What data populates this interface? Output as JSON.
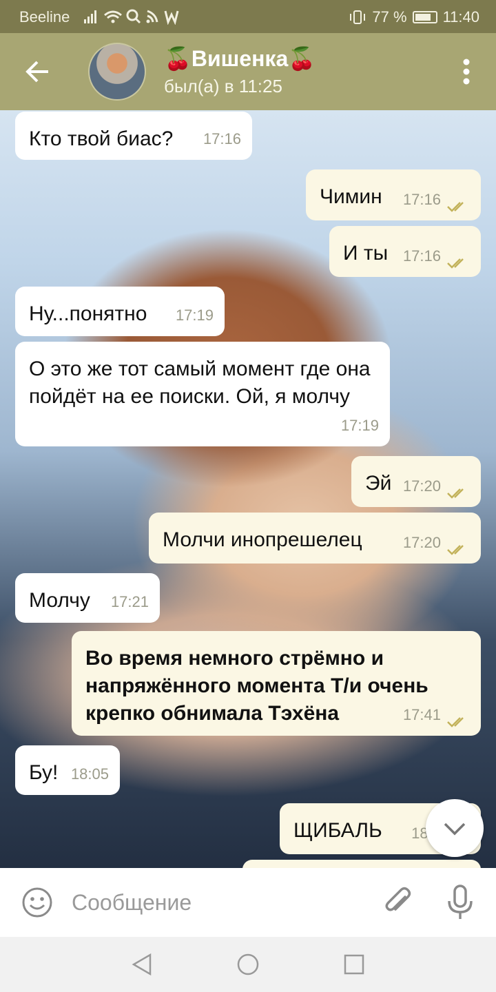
{
  "status_bar": {
    "carrier": "Beeline",
    "battery": "77 %",
    "battery_level": 0.77,
    "time": "11:40"
  },
  "header": {
    "contact_name": "🍒Вишенка🍒",
    "status": "был(а) в 11:25"
  },
  "messages": [
    {
      "dir": "in",
      "text": "Кто твой биас?",
      "time": "17:16"
    },
    {
      "dir": "out",
      "text": "Чимин",
      "time": "17:16",
      "read": true
    },
    {
      "dir": "out",
      "text": "И ты",
      "time": "17:16",
      "read": true
    },
    {
      "dir": "in",
      "text": "Ну...понятно",
      "time": "17:19"
    },
    {
      "dir": "in",
      "text": "О это же тот самый момент где она пойдёт на ее поиски. Ой, я молчу",
      "time": "17:19"
    },
    {
      "dir": "out",
      "text": "Эй",
      "time": "17:20",
      "read": true
    },
    {
      "dir": "out",
      "text": "Молчи инопрешелец",
      "time": "17:20",
      "read": true
    },
    {
      "dir": "in",
      "text": "Молчу",
      "time": "17:21"
    },
    {
      "dir": "out",
      "text": "Во время немного стрёмно и напряжённого момента Т/и очень крепко обнимала Тэхёна",
      "time": "17:41",
      "read": true,
      "bold": true
    },
    {
      "dir": "in",
      "text": "Бу!",
      "time": "18:05"
    },
    {
      "dir": "out",
      "text": "ЩИБАЛЬ",
      "time": "18:0",
      "read": true
    }
  ],
  "input": {
    "placeholder": "Сообщение"
  },
  "colors": {
    "header": "#a8a673",
    "status_bar": "#7d7a4e",
    "incoming_bubble": "#ffffff",
    "outgoing_bubble": "#fbf7e4",
    "read_check": "#c2b25a"
  },
  "icons": [
    "back-arrow-icon",
    "more-vert-icon",
    "emoji-icon",
    "paperclip-icon",
    "mic-icon",
    "chevron-down-icon",
    "nav-back-icon",
    "nav-home-icon",
    "nav-recent-icon"
  ]
}
